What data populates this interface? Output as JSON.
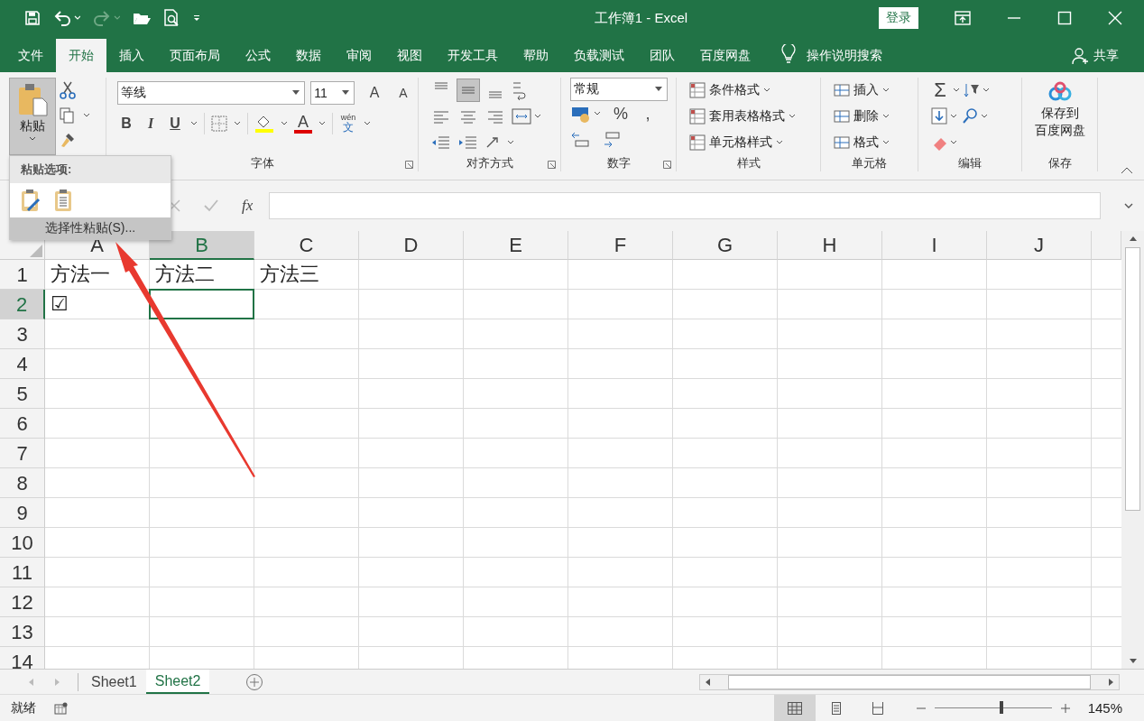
{
  "title_bar": {
    "title": "工作簿1 - Excel",
    "login": "登录"
  },
  "tabs": [
    {
      "label": "文件",
      "selected": false
    },
    {
      "label": "开始",
      "selected": true
    },
    {
      "label": "插入",
      "selected": false
    },
    {
      "label": "页面布局",
      "selected": false
    },
    {
      "label": "公式",
      "selected": false
    },
    {
      "label": "数据",
      "selected": false
    },
    {
      "label": "审阅",
      "selected": false
    },
    {
      "label": "视图",
      "selected": false
    },
    {
      "label": "开发工具",
      "selected": false
    },
    {
      "label": "帮助",
      "selected": false
    },
    {
      "label": "负载测试",
      "selected": false
    },
    {
      "label": "团队",
      "selected": false
    },
    {
      "label": "百度网盘",
      "selected": false
    }
  ],
  "tell_me": "操作说明搜索",
  "share": "共享",
  "ribbon": {
    "paste": "粘贴",
    "font": {
      "name": "等线",
      "size": "11",
      "grow": "A",
      "shrink": "A",
      "bold": "B",
      "italic": "I",
      "underline": "U",
      "font_color": "A",
      "phonetic_top": "wén",
      "phonetic_bottom": "文",
      "label": "字体"
    },
    "alignment": {
      "vertical": [
        {
          "kind": "top",
          "selected": false
        },
        {
          "kind": "middle",
          "selected": true
        },
        {
          "kind": "bottom",
          "selected": false
        }
      ],
      "label": "对齐方式"
    },
    "number": {
      "format": "常规",
      "percent": "%",
      "comma": ",",
      "label": "数字"
    },
    "styles": {
      "items": [
        "条件格式",
        "套用表格格式",
        "单元格样式"
      ],
      "label": "样式"
    },
    "cells": {
      "items": [
        "插入",
        "删除",
        "格式"
      ],
      "label": "单元格"
    },
    "editing": {
      "sum": "Σ",
      "label": "编辑"
    },
    "save": {
      "line1": "保存到",
      "line2": "百度网盘",
      "label": "保存"
    }
  },
  "paste_menu": {
    "heading": "粘贴选项:",
    "special": "选择性粘贴(S)..."
  },
  "formula_bar": {
    "fx": "fx"
  },
  "columns": [
    {
      "label": "A",
      "selected": false
    },
    {
      "label": "B",
      "selected": true
    },
    {
      "label": "C",
      "selected": false
    },
    {
      "label": "D",
      "selected": false
    },
    {
      "label": "E",
      "selected": false
    },
    {
      "label": "F",
      "selected": false
    },
    {
      "label": "G",
      "selected": false
    },
    {
      "label": "H",
      "selected": false
    },
    {
      "label": "I",
      "selected": false
    },
    {
      "label": "J",
      "selected": false
    }
  ],
  "rows": [
    {
      "label": "1",
      "selected": false,
      "cells": [
        "方法一",
        "方法二",
        "方法三"
      ]
    },
    {
      "label": "2",
      "selected": true,
      "cells": [
        "☑"
      ]
    },
    {
      "label": "3",
      "selected": false,
      "cells": []
    },
    {
      "label": "4",
      "selected": false,
      "cells": []
    },
    {
      "label": "5",
      "selected": false,
      "cells": []
    },
    {
      "label": "6",
      "selected": false,
      "cells": []
    },
    {
      "label": "7",
      "selected": false,
      "cells": []
    },
    {
      "label": "8",
      "selected": false,
      "cells": []
    },
    {
      "label": "9",
      "selected": false,
      "cells": []
    },
    {
      "label": "10",
      "selected": false,
      "cells": []
    },
    {
      "label": "11",
      "selected": false,
      "cells": []
    },
    {
      "label": "12",
      "selected": false,
      "cells": []
    },
    {
      "label": "13",
      "selected": false,
      "cells": []
    },
    {
      "label": "14",
      "selected": false,
      "cells": []
    }
  ],
  "sheets": [
    {
      "label": "Sheet1",
      "selected": false
    },
    {
      "label": "Sheet2",
      "selected": true
    }
  ],
  "status_bar": {
    "status": "就绪",
    "view_buttons": [
      {
        "kind": "normal",
        "selected": true
      },
      {
        "kind": "page_layout",
        "selected": false
      },
      {
        "kind": "page_break",
        "selected": false
      }
    ],
    "zoom": {
      "level": 0.57
    },
    "zoom_text": "145%"
  }
}
